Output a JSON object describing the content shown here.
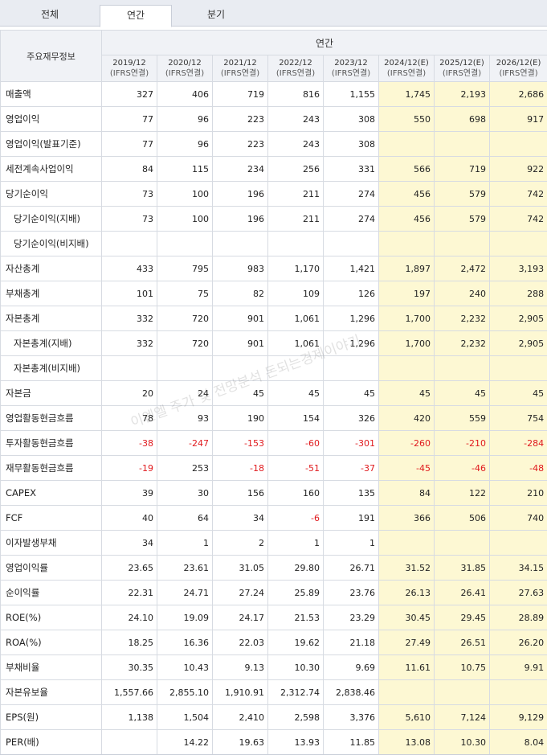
{
  "tabs": [
    {
      "label": "전체"
    },
    {
      "label": "연간"
    },
    {
      "label": "분기"
    }
  ],
  "header": {
    "row_label": "주요재무정보",
    "group_label": "연간",
    "columns": [
      {
        "period": "2019/12",
        "basis": "(IFRS연결)",
        "estimate": false
      },
      {
        "period": "2020/12",
        "basis": "(IFRS연결)",
        "estimate": false
      },
      {
        "period": "2021/12",
        "basis": "(IFRS연결)",
        "estimate": false
      },
      {
        "period": "2022/12",
        "basis": "(IFRS연결)",
        "estimate": false
      },
      {
        "period": "2023/12",
        "basis": "(IFRS연결)",
        "estimate": false
      },
      {
        "period": "2024/12(E)",
        "basis": "(IFRS연결)",
        "estimate": true
      },
      {
        "period": "2025/12(E)",
        "basis": "(IFRS연결)",
        "estimate": true
      },
      {
        "period": "2026/12(E)",
        "basis": "(IFRS연결)",
        "estimate": true
      }
    ]
  },
  "rows": [
    {
      "label": "매출액",
      "indent": false,
      "values": [
        "327",
        "406",
        "719",
        "816",
        "1,155",
        "1,745",
        "2,193",
        "2,686"
      ]
    },
    {
      "label": "영업이익",
      "indent": false,
      "values": [
        "77",
        "96",
        "223",
        "243",
        "308",
        "550",
        "698",
        "917"
      ]
    },
    {
      "label": "영업이익(발표기준)",
      "indent": false,
      "values": [
        "77",
        "96",
        "223",
        "243",
        "308",
        "",
        "",
        ""
      ]
    },
    {
      "label": "세전계속사업이익",
      "indent": false,
      "values": [
        "84",
        "115",
        "234",
        "256",
        "331",
        "566",
        "719",
        "922"
      ]
    },
    {
      "label": "당기순이익",
      "indent": false,
      "values": [
        "73",
        "100",
        "196",
        "211",
        "274",
        "456",
        "579",
        "742"
      ]
    },
    {
      "label": "당기순이익(지배)",
      "indent": true,
      "values": [
        "73",
        "100",
        "196",
        "211",
        "274",
        "456",
        "579",
        "742"
      ]
    },
    {
      "label": "당기순이익(비지배)",
      "indent": true,
      "values": [
        "",
        "",
        "",
        "",
        "",
        "",
        "",
        ""
      ]
    },
    {
      "label": "자산총계",
      "indent": false,
      "values": [
        "433",
        "795",
        "983",
        "1,170",
        "1,421",
        "1,897",
        "2,472",
        "3,193"
      ]
    },
    {
      "label": "부채총계",
      "indent": false,
      "values": [
        "101",
        "75",
        "82",
        "109",
        "126",
        "197",
        "240",
        "288"
      ]
    },
    {
      "label": "자본총계",
      "indent": false,
      "values": [
        "332",
        "720",
        "901",
        "1,061",
        "1,296",
        "1,700",
        "2,232",
        "2,905"
      ]
    },
    {
      "label": "자본총계(지배)",
      "indent": true,
      "values": [
        "332",
        "720",
        "901",
        "1,061",
        "1,296",
        "1,700",
        "2,232",
        "2,905"
      ]
    },
    {
      "label": "자본총계(비지배)",
      "indent": true,
      "values": [
        "",
        "",
        "",
        "",
        "",
        "",
        "",
        ""
      ]
    },
    {
      "label": "자본금",
      "indent": false,
      "values": [
        "20",
        "24",
        "45",
        "45",
        "45",
        "45",
        "45",
        "45"
      ]
    },
    {
      "label": "영업활동현금흐름",
      "indent": false,
      "values": [
        "78",
        "93",
        "190",
        "154",
        "326",
        "420",
        "559",
        "754"
      ]
    },
    {
      "label": "투자활동현금흐름",
      "indent": false,
      "values": [
        "-38",
        "-247",
        "-153",
        "-60",
        "-301",
        "-260",
        "-210",
        "-284"
      ]
    },
    {
      "label": "재무활동현금흐름",
      "indent": false,
      "values": [
        "-19",
        "253",
        "-18",
        "-51",
        "-37",
        "-45",
        "-46",
        "-48"
      ]
    },
    {
      "label": "CAPEX",
      "indent": false,
      "values": [
        "39",
        "30",
        "156",
        "160",
        "135",
        "84",
        "122",
        "210"
      ]
    },
    {
      "label": "FCF",
      "indent": false,
      "values": [
        "40",
        "64",
        "34",
        "-6",
        "191",
        "366",
        "506",
        "740"
      ]
    },
    {
      "label": "이자발생부채",
      "indent": false,
      "values": [
        "34",
        "1",
        "2",
        "1",
        "1",
        "",
        "",
        ""
      ]
    },
    {
      "label": "영업이익률",
      "indent": false,
      "values": [
        "23.65",
        "23.61",
        "31.05",
        "29.80",
        "26.71",
        "31.52",
        "31.85",
        "34.15"
      ]
    },
    {
      "label": "순이익률",
      "indent": false,
      "values": [
        "22.31",
        "24.71",
        "27.24",
        "25.89",
        "23.76",
        "26.13",
        "26.41",
        "27.63"
      ]
    },
    {
      "label": "ROE(%)",
      "indent": false,
      "values": [
        "24.10",
        "19.09",
        "24.17",
        "21.53",
        "23.29",
        "30.45",
        "29.45",
        "28.89"
      ]
    },
    {
      "label": "ROA(%)",
      "indent": false,
      "values": [
        "18.25",
        "16.36",
        "22.03",
        "19.62",
        "21.18",
        "27.49",
        "26.51",
        "26.20"
      ]
    },
    {
      "label": "부채비율",
      "indent": false,
      "values": [
        "30.35",
        "10.43",
        "9.13",
        "10.30",
        "9.69",
        "11.61",
        "10.75",
        "9.91"
      ]
    },
    {
      "label": "자본유보율",
      "indent": false,
      "values": [
        "1,557.66",
        "2,855.10",
        "1,910.91",
        "2,312.74",
        "2,838.46",
        "",
        "",
        ""
      ]
    },
    {
      "label": "EPS(원)",
      "indent": false,
      "values": [
        "1,138",
        "1,504",
        "2,410",
        "2,598",
        "3,376",
        "5,610",
        "7,124",
        "9,129"
      ]
    },
    {
      "label": "PER(배)",
      "indent": false,
      "values": [
        "",
        "14.22",
        "19.63",
        "13.93",
        "11.85",
        "13.08",
        "10.30",
        "8.04"
      ]
    }
  ],
  "watermark": "이엔엘 주가 및 전망분석 돈되는경제이야기",
  "colors": {
    "negative": "#e0191d",
    "estimate_bg": "#fdf8d3",
    "header_bg": "#f0f2f6",
    "border": "#d7dbe2"
  }
}
